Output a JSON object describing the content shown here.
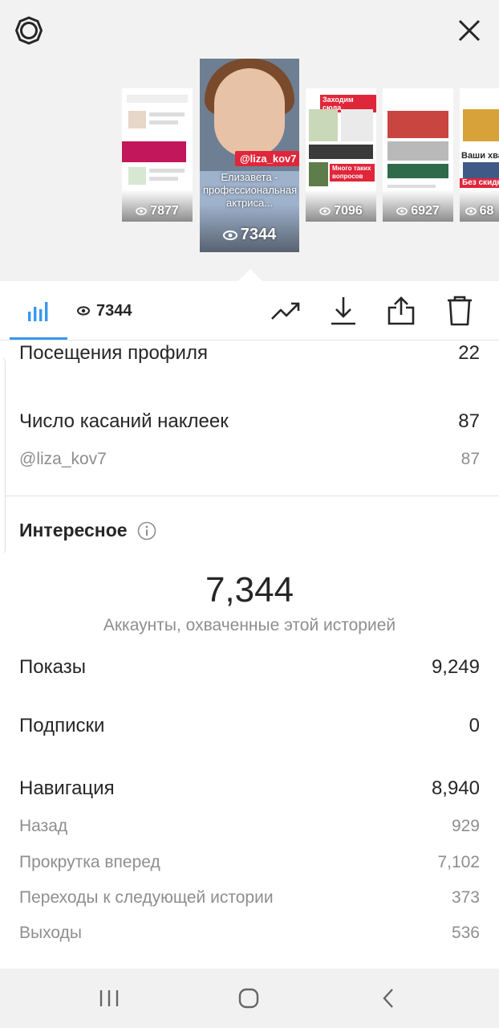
{
  "header": {
    "icons": {
      "settings": "gear-icon",
      "close": "close-icon"
    }
  },
  "stories": [
    {
      "views": "7877"
    },
    {
      "views": "7344",
      "tag": "@liza_kov7",
      "caption": "Елизавета - профессиональная актриса...",
      "selected": true
    },
    {
      "views": "7096",
      "banner": "Заходим сюда",
      "caption": "Много таких вопросов"
    },
    {
      "views": "6927"
    },
    {
      "views": "68",
      "caption": "Ваши хва",
      "badge": "Без скидки"
    }
  ],
  "toolbar": {
    "insights_tab_icon": "bar-chart-icon",
    "viewers_count": "7344",
    "icons": [
      "trending-up-icon",
      "download-icon",
      "share-icon",
      "trash-icon"
    ],
    "accent": "#3897f0"
  },
  "interactions": {
    "profile_visits_label": "Посещения профиля",
    "profile_visits_value": "22",
    "sticker_taps_label": "Число касаний наклеек",
    "sticker_taps_value": "87",
    "sticker_mention_label": "@liza_kov7",
    "sticker_mention_value": "87"
  },
  "discovery": {
    "title": "Интересное",
    "reach_value": "7,344",
    "reach_label": "Аккаунты, охваченные этой историей",
    "impressions_label": "Показы",
    "impressions_value": "9,249",
    "follows_label": "Подписки",
    "follows_value": "0",
    "navigation_label": "Навигация",
    "navigation_value": "8,940",
    "back_label": "Назад",
    "back_value": "929",
    "forward_label": "Прокрутка вперед",
    "forward_value": "7,102",
    "next_story_label": "Переходы к следующей истории",
    "next_story_value": "373",
    "exits_label": "Выходы",
    "exits_value": "536"
  },
  "system_nav": {
    "icons": [
      "recents-icon",
      "home-icon",
      "back-icon"
    ]
  }
}
